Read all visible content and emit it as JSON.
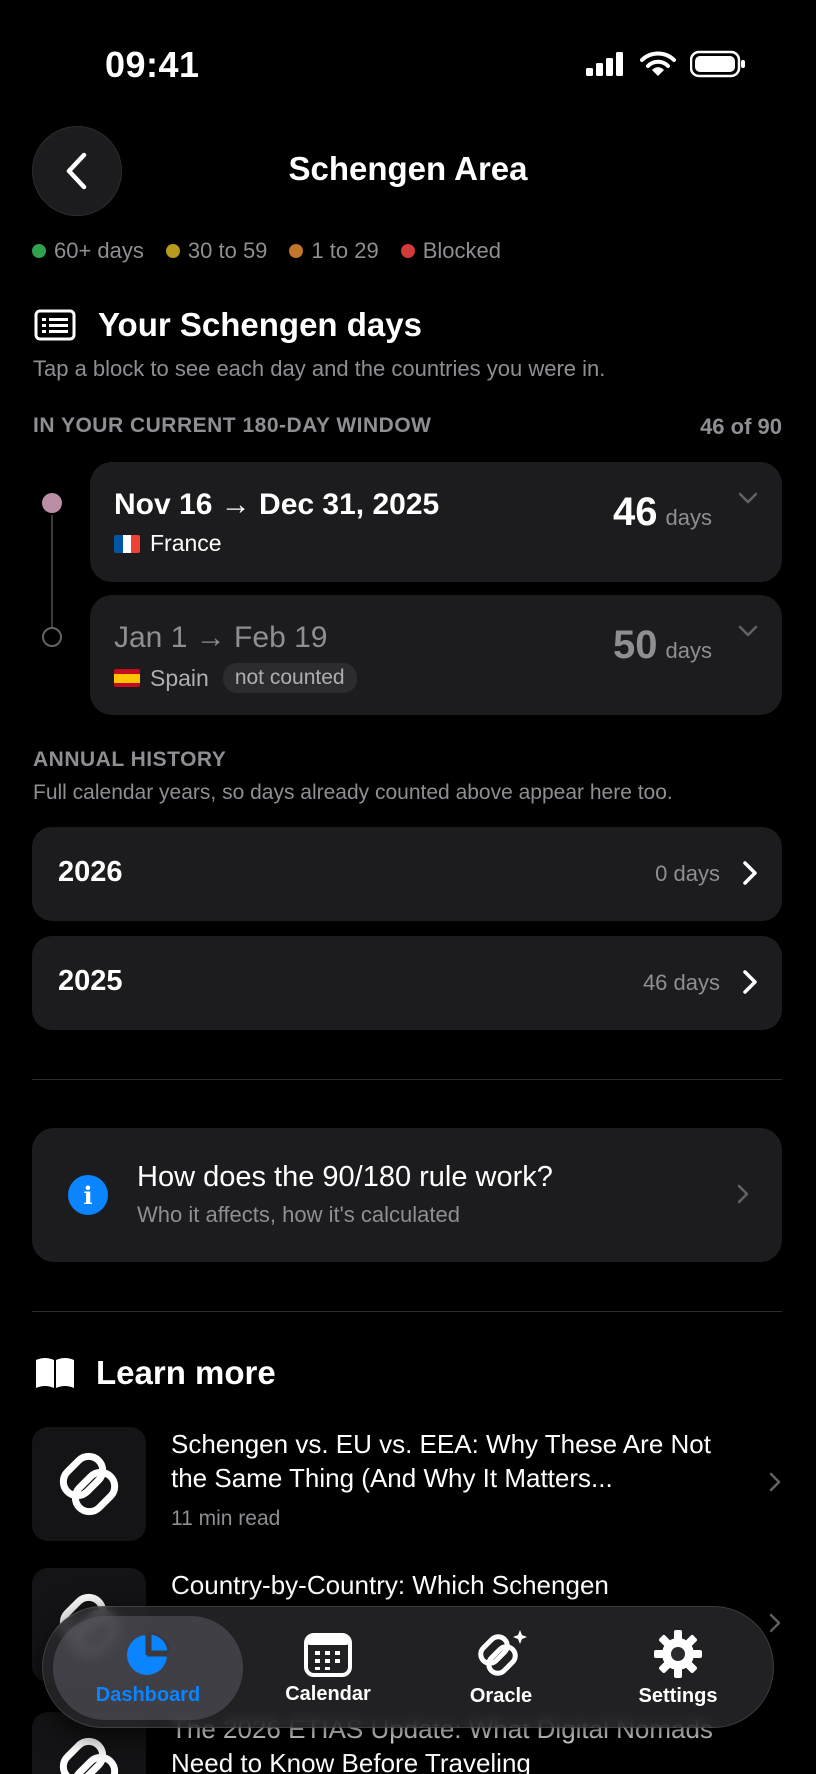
{
  "status_bar": {
    "time": "09:41"
  },
  "header": {
    "title": "Schengen Area"
  },
  "legend": [
    {
      "label": "60+ days",
      "color": "#30a14e"
    },
    {
      "label": "30 to 59",
      "color": "#b89a1e"
    },
    {
      "label": "1 to 29",
      "color": "#c2762c"
    },
    {
      "label": "Blocked",
      "color": "#d13b3b"
    }
  ],
  "your_days": {
    "title": "Your Schengen days",
    "subtitle": "Tap a block to see each day and the countries you were in.",
    "window_label": "IN YOUR CURRENT 180-DAY WINDOW",
    "window_count": "46 of 90",
    "periods": [
      {
        "range": "Nov 16 → Dec 31, 2025",
        "flag": "🇫🇷",
        "country": "France",
        "days": "46",
        "unit": "days"
      },
      {
        "range": "Jan 1 → Feb 19",
        "flag": "🇪🇸",
        "country": "Spain",
        "badge": "not counted",
        "days": "50",
        "unit": "days"
      }
    ]
  },
  "annual": {
    "label": "ANNUAL HISTORY",
    "subtitle": "Full calendar years, so days already counted above appear here too.",
    "years": [
      {
        "year": "2026",
        "days": "0 days"
      },
      {
        "year": "2025",
        "days": "46 days"
      }
    ]
  },
  "info": {
    "title": "How does the 90/180 rule work?",
    "subtitle": "Who it affects, how it's calculated"
  },
  "learn_more": {
    "title": "Learn more",
    "articles": [
      {
        "title": "Schengen vs. EU vs. EEA: Why These Are Not the Same Thing (And Why It Matters...",
        "meta": "11 min read"
      },
      {
        "title": "Country-by-Country: Which Schengen",
        "meta": ""
      },
      {
        "title": "The 2026 ETIAS Update: What Digital Nomads Need to Know Before Traveling",
        "meta": ""
      }
    ]
  },
  "tabs": [
    {
      "label": "Dashboard",
      "icon": "pie-chart-icon",
      "active": true
    },
    {
      "label": "Calendar",
      "icon": "calendar-icon"
    },
    {
      "label": "Oracle",
      "icon": "oracle-knot-icon"
    },
    {
      "label": "Settings",
      "icon": "gear-icon"
    }
  ]
}
